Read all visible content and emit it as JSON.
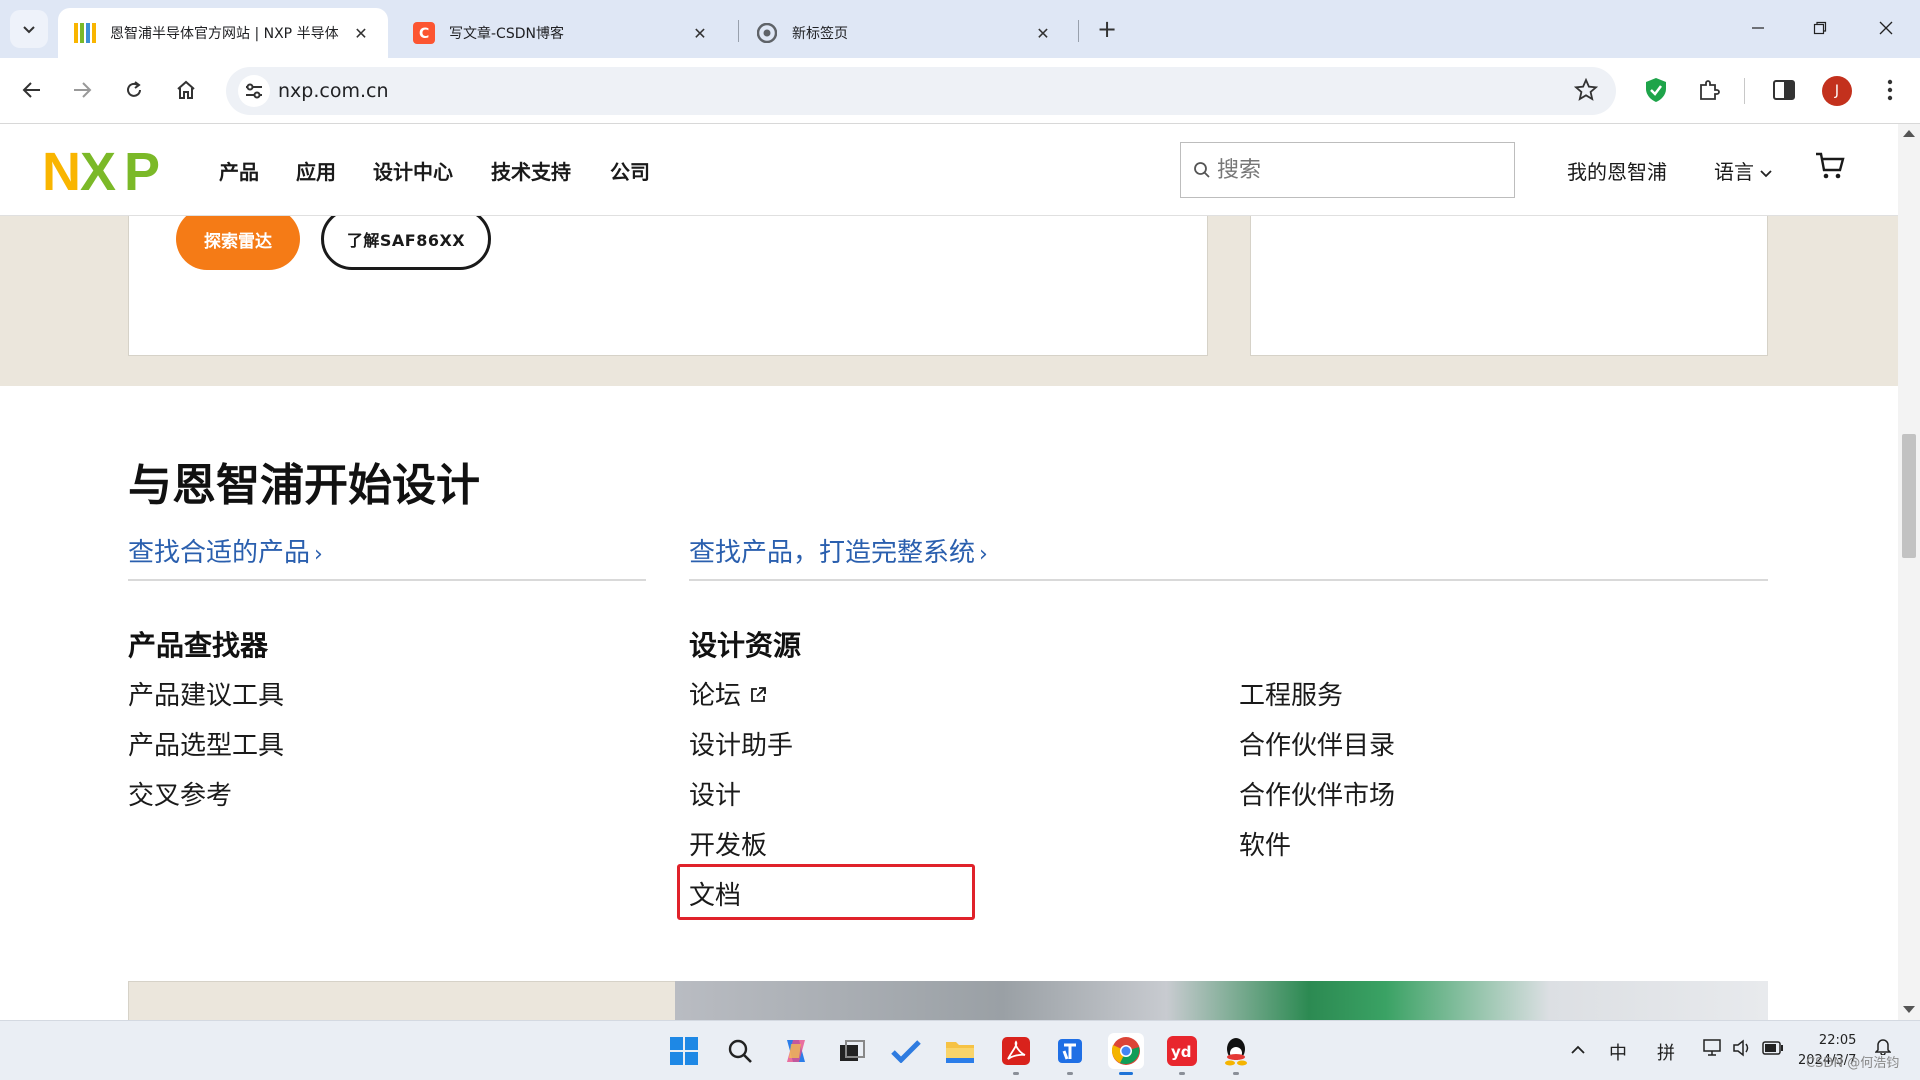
{
  "browser": {
    "tabs": [
      {
        "title": "恩智浦半导体官方网站 | NXP 半导体",
        "favicon": "nxp-favicon-icon",
        "active": true
      },
      {
        "title": "写文章-CSDN博客",
        "favicon": "csdn-favicon-icon",
        "active": false
      },
      {
        "title": "新标签页",
        "favicon": "chrome-favicon-icon",
        "active": false
      }
    ],
    "new_tab_label": "+",
    "url": "nxp.com.cn",
    "profile_initial": "J"
  },
  "header": {
    "logo_text": "NXP",
    "nav": [
      "产品",
      "应用",
      "设计中心",
      "技术支持",
      "公司"
    ],
    "search_placeholder": "搜索",
    "my_nxp": "我的恩智浦",
    "language": "语言"
  },
  "promo": {
    "explore_button": "探索雷达",
    "learn_button": "了解SAF86XX"
  },
  "design": {
    "title": "与恩智浦开始设计",
    "link_left": "查找合适的产品",
    "link_right": "查找产品，打造完整系统",
    "chevron": "›",
    "col1": {
      "heading": "产品查找器",
      "items": [
        "产品建议工具",
        "产品选型工具",
        "交叉参考"
      ]
    },
    "col2": {
      "heading": "设计资源",
      "items": [
        "论坛",
        "设计助手",
        "设计",
        "开发板",
        "文档"
      ]
    },
    "col3": {
      "items": [
        "工程服务",
        "合作伙伴目录",
        "合作伙伴市场",
        "软件"
      ]
    }
  },
  "taskbar": {
    "ime_mode": "中",
    "ime_input": "拼",
    "time": "22:05",
    "date": "2024/3/7",
    "watermark": "CSDN @何浩钧"
  },
  "colors": {
    "accent_orange": "#f57b16",
    "link_blue": "#2a5fae",
    "highlight_red": "#e0222a",
    "band_beige": "#ebe6dc"
  }
}
